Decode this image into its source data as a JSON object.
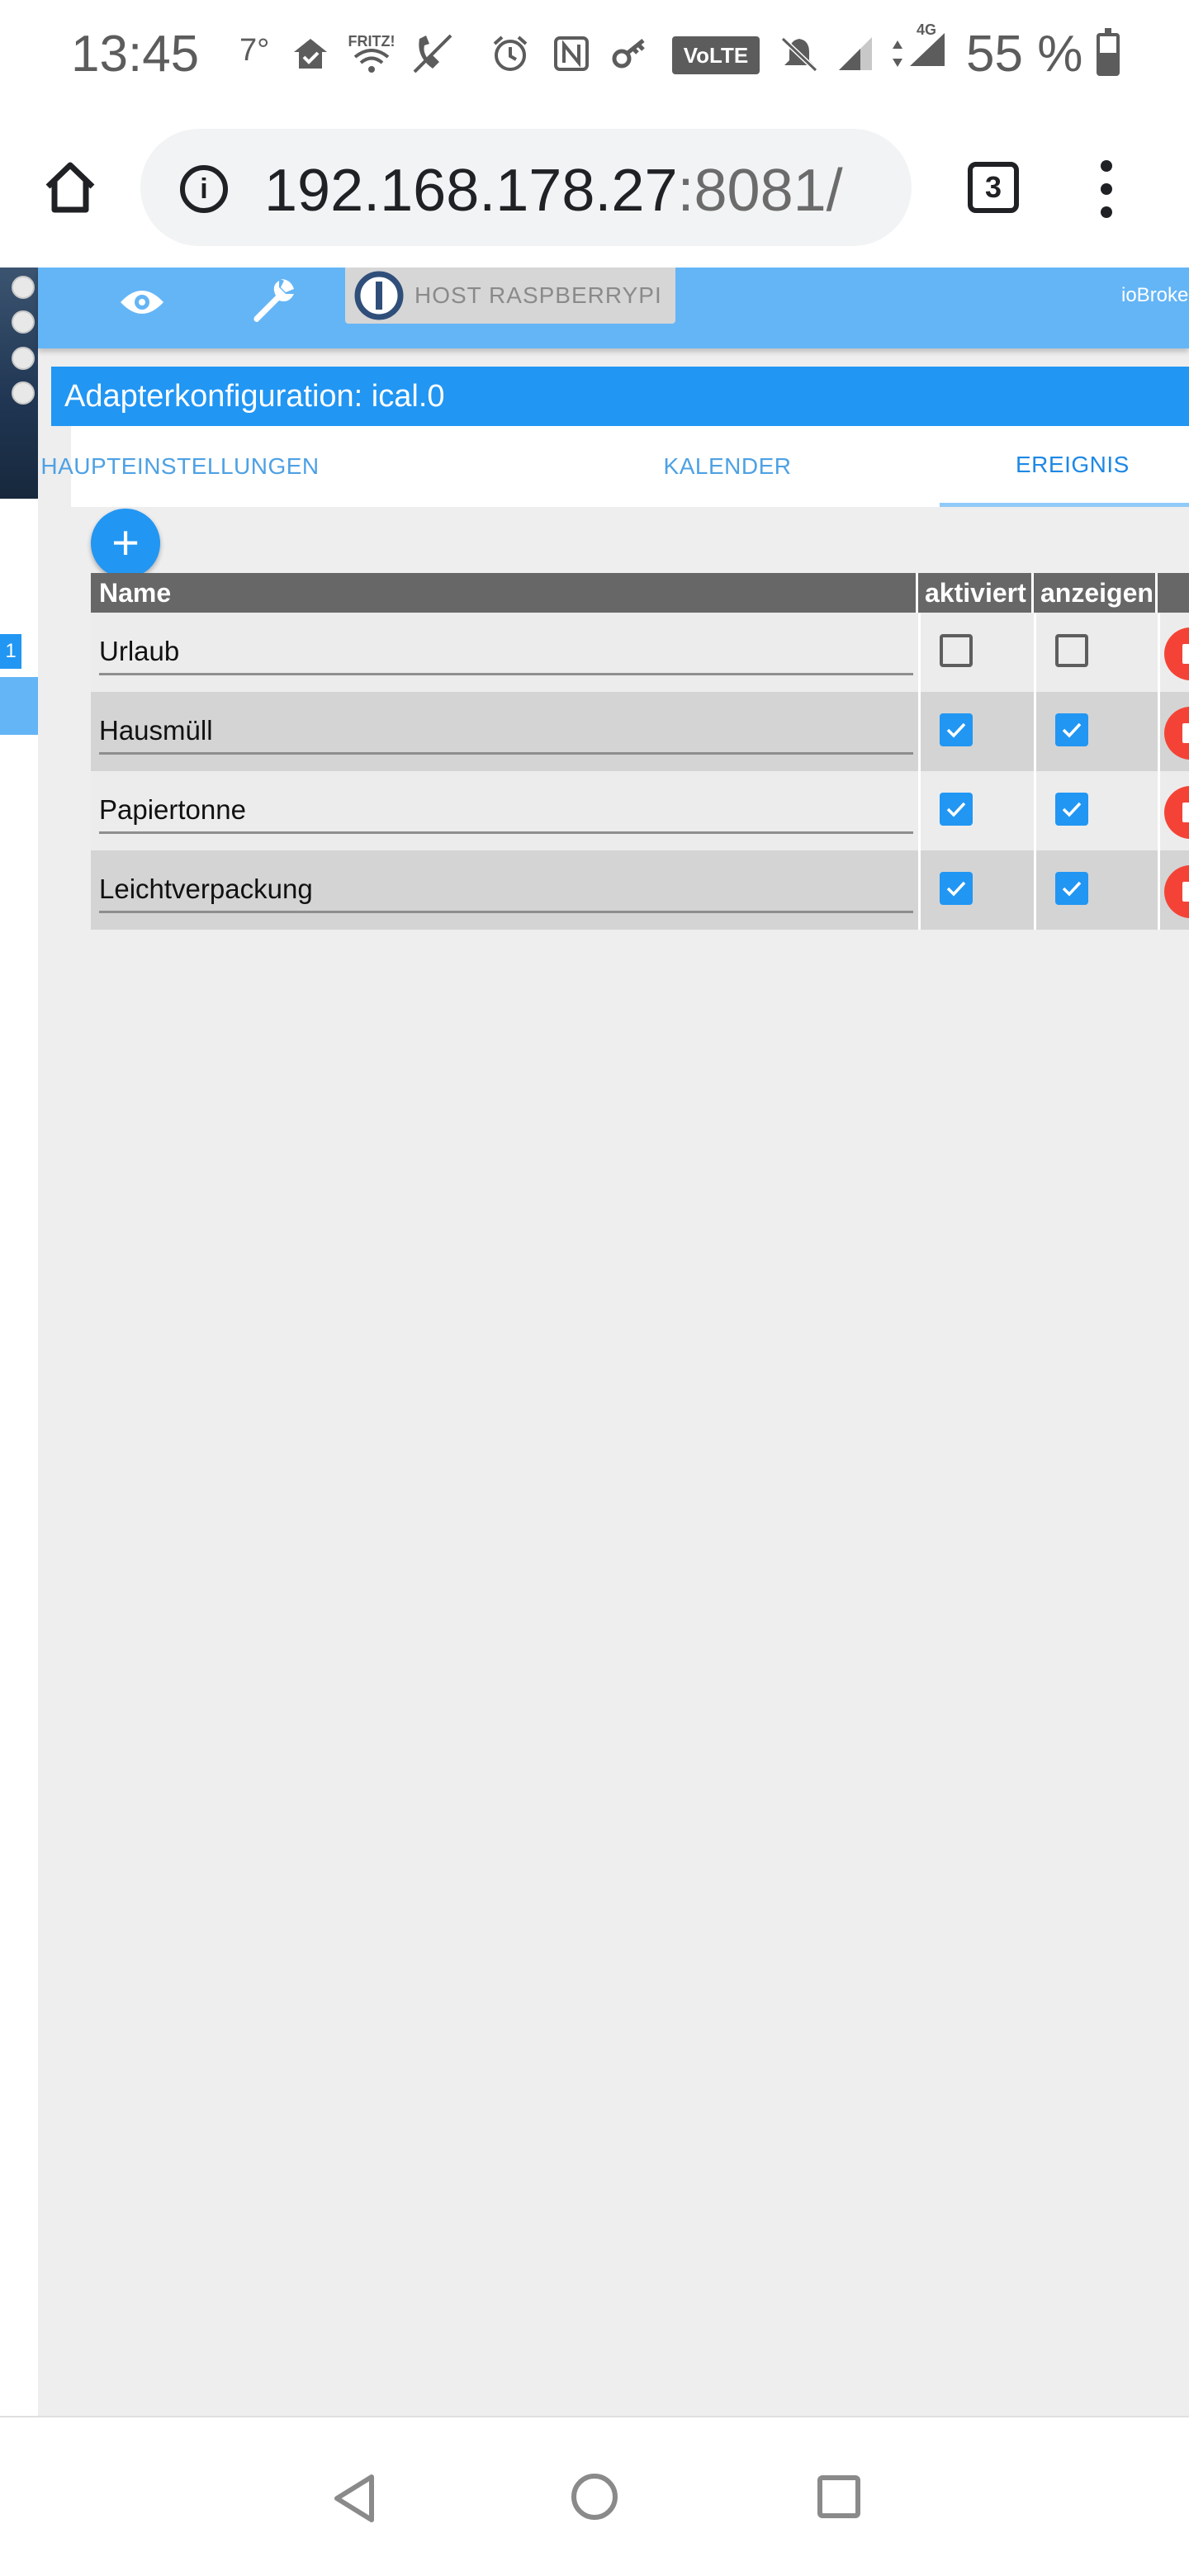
{
  "status_bar": {
    "time": "13:45",
    "temperature": "7°",
    "fritz_label": "FRITZ!",
    "volte_label": "VoLTE",
    "network_label": "4G",
    "battery_text": "55 %",
    "battery_level": 0.55
  },
  "browser": {
    "url_host": "192.168.178.27",
    "url_port": ":8081/",
    "tab_count": "3"
  },
  "app": {
    "host_label": "HOST RASPBERRYPI",
    "brand_label": "ioBroke",
    "left_badge": "1",
    "dialog_title": "Adapterkonfiguration: ical.0",
    "tabs": [
      {
        "label": "HAUPTEINSTELLUNGEN",
        "active": false
      },
      {
        "label": "KALENDER",
        "active": false
      },
      {
        "label": "EREIGNIS",
        "active": true
      }
    ],
    "add_button_label": "+",
    "table": {
      "headers": {
        "name": "Name",
        "enabled": "aktiviert",
        "display": "anzeigen"
      },
      "rows": [
        {
          "name": "Urlaub",
          "enabled": false,
          "display": false
        },
        {
          "name": "Hausmüll",
          "enabled": true,
          "display": true
        },
        {
          "name": "Papiertonne",
          "enabled": true,
          "display": true
        },
        {
          "name": "Leichtverpackung",
          "enabled": true,
          "display": true
        }
      ]
    }
  },
  "colors": {
    "primary": "#2196f3",
    "topbar": "#64b5f6",
    "header_gray": "#676767",
    "delete_red": "#f44336",
    "background": "#eeeeef"
  }
}
